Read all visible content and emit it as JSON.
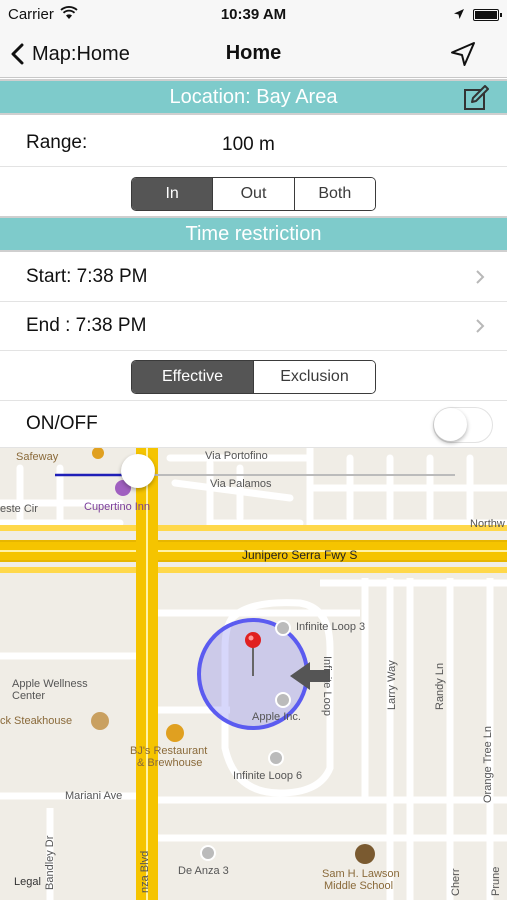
{
  "status_bar": {
    "carrier": "Carrier",
    "time": "10:39 AM",
    "wifi_icon": "wifi-icon",
    "location_icon": "location-arrow-icon",
    "battery_icon": "battery-icon"
  },
  "nav": {
    "back_label": "Map:Home",
    "title": "Home",
    "right_icon": "location-arrow-icon"
  },
  "location_header": {
    "text": "Location:  Bay Area",
    "edit_icon": "edit-icon"
  },
  "range": {
    "label": "Range:",
    "value": "100 m"
  },
  "direction_segment": {
    "options": [
      "In",
      "Out",
      "Both"
    ],
    "selected": "In"
  },
  "time_header": {
    "text": "Time restriction"
  },
  "start": {
    "label": "Start: 7:38 PM"
  },
  "end": {
    "label": "End  : 7:38 PM"
  },
  "mode_segment": {
    "options": [
      "Effective",
      "Exclusion"
    ],
    "selected": "Effective"
  },
  "onoff": {
    "label": "ON/OFF",
    "on": false
  },
  "map": {
    "labels": {
      "safeway": "Safeway",
      "via_portofino": "Via Portofino",
      "via_palamos": "Via Palamos",
      "este_cir": "este Cir",
      "cupertino_inn": "Cupertino Inn",
      "northw": "Northw",
      "junipero": "Junipero Serra Fwy S",
      "infinite_loop_3": "Infinite Loop 3",
      "infinite_loop": "Infinite Loop",
      "larry_way": "Larry Way",
      "randy_ln": "Randy Ln",
      "orange_tree": "Orange Tree Ln",
      "apple_wellness_1": "Apple Wellness",
      "apple_wellness_2": "Center",
      "steakhouse": "ck Steakhouse",
      "apple_inc": "Apple Inc.",
      "bjs_1": "BJ's Restaurant",
      "bjs_2": "& Brewhouse",
      "infinite_loop_6": "Infinite Loop 6",
      "mariani": "Mariani Ave",
      "bandley": "Bandley Dr",
      "de_anza_blvd": "nza Blvd",
      "de_anza_3": "De Anza 3",
      "sam_lawson_1": "Sam H. Lawson",
      "sam_lawson_2": "Middle School",
      "legal": "Legal",
      "cherry": "Cherr",
      "prune": "Prune"
    },
    "geofence_color": "#5b5bf0",
    "highway_color": "#f5c400"
  }
}
